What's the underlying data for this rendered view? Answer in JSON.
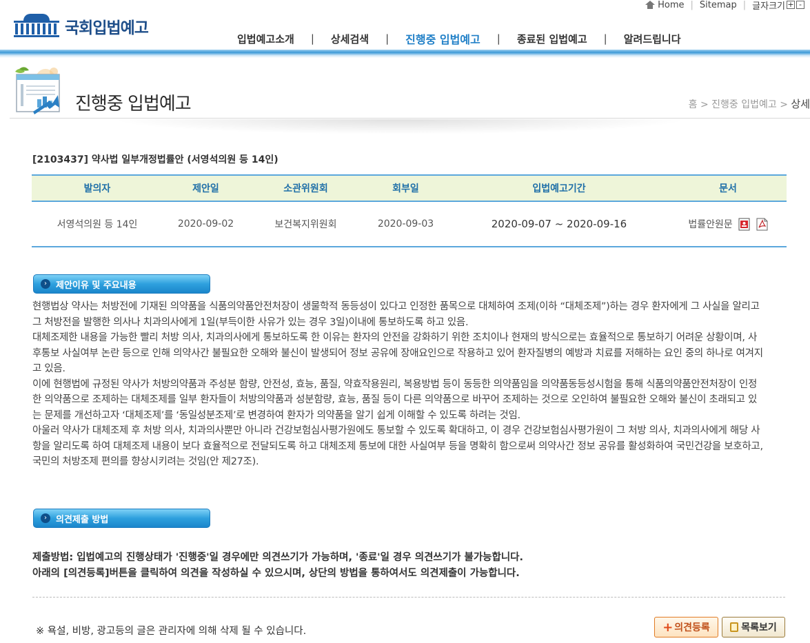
{
  "util": {
    "home": "Home",
    "sitemap": "Sitemap",
    "font_size": "글자크기",
    "plus": "+",
    "minus": "-"
  },
  "logo": {
    "text": "국회입법예고"
  },
  "nav": {
    "items": [
      {
        "label": "입법예고소개"
      },
      {
        "label": "상세검색"
      },
      {
        "label": "진행중 입법예고"
      },
      {
        "label": "종료된 입법예고"
      },
      {
        "label": "알려드립니다"
      }
    ],
    "separator": "|"
  },
  "page": {
    "title": "진행중 입법예고",
    "breadcrumb": {
      "home": "홈",
      "sep": ">",
      "section": "진행중 입법예고",
      "current": "상세"
    }
  },
  "bill": {
    "title": "[2103437] 약사법 일부개정법률안 (서영석의원 등 14인)",
    "headers": [
      "발의자",
      "제안일",
      "소관위원회",
      "회부일",
      "입법예고기간",
      "문서"
    ],
    "row": {
      "proposer": "서영석의원 등 14인",
      "proposal_date": "2020-09-02",
      "committee": "보건복지위원회",
      "referral_date": "2020-09-03",
      "period": "2020-09-07 ~ 2020-09-16",
      "document": "법률안원문"
    }
  },
  "sections": {
    "reason_heading": "제안이유 및 주요내용",
    "reason_paragraphs": [
      "현행법상 약사는 처방전에 기재된 의약품을 식품의약품안전처장이 생물학적 동등성이 있다고 인정한 품목으로 대체하여 조제(이하 “대체조제”)하는 경우 환자에게 그 사실을 알리고 그 처방전을 발행한 의사나 치과의사에게 1일(부득이한 사유가 있는 경우 3일)이내에 통보하도록 하고 있음.",
      "대체조제한 내용을 가능한 빨리 처방 의사, 치과의사에게 통보하도록 한 이유는 환자의 안전을 강화하기 위한 조치이나 현재의 방식으로는 효율적으로 통보하기 어려운 상황이며, 사후통보 사실여부 논란 등으로 인해 의약사간 불필요한 오해와 불신이 발생되어 정보 공유에 장애요인으로 작용하고 있어 환자질병의 예방과 치료를 저해하는 요인 중의 하나로 여겨지고 있음.",
      "이에 현행법에 규정된 약사가 처방의약품과 주성분 함량, 안전성, 효능, 품질, 약효작용원리, 복용방법 등이 동등한 의약품임을 의약품동등성시험을 통해 식품의약품안전처장이 인정한 의약품으로 조제하는 대체조제를 일부 환자들이 처방의약품과 성분함량, 효능, 품질 등이 다른 의약품으로 바꾸어 조제하는 것으로 오인하여 불필요한 오해와 불신이 초래되고 있는 문제를 개선하고자 ‘대체조제’를 ‘동일성분조제’로 변경하여 환자가 의약품을 알기 쉽게 이해할 수 있도록 하려는 것임.",
      "아울러 약사가 대체조제 후 처방 의사, 치과의사뿐만 아니라 건강보험심사평가원에도 통보할 수 있도록 확대하고, 이 경우 건강보험심사평가원이 그 처방 의사, 치과의사에게 해당 사항을 알리도록 하여 대체조제 내용이 보다 효율적으로 전달되도록 하고 대체조제 통보에 대한 사실여부 등을 명확히 함으로써 의약사간 정보 공유를 활성화하여 국민건강을 보호하고, 국민의 처방조제 편의를 향상시키려는 것임(안 제27조)."
    ],
    "opinion_heading": "의견제출 방법",
    "opinion_lines": [
      "제출방법: 입법예고의 진행상태가 '진행중'일 경우에만 의견쓰기가 가능하며, '종료'일 경우 의견쓰기가 불가능합니다.",
      "아래의 [의견등록]버튼을 클릭하여 의견을 작성하실 수 있으시며, 상단의 방법을 통하여서도 의견제출이 가능합니다."
    ]
  },
  "footer": {
    "notice": "※ 욕설, 비방, 광고등의 글은 관리자에 의해 삭제 될 수 있습니다.",
    "opinion_button": "의견등록",
    "list_button": "목록보기"
  }
}
